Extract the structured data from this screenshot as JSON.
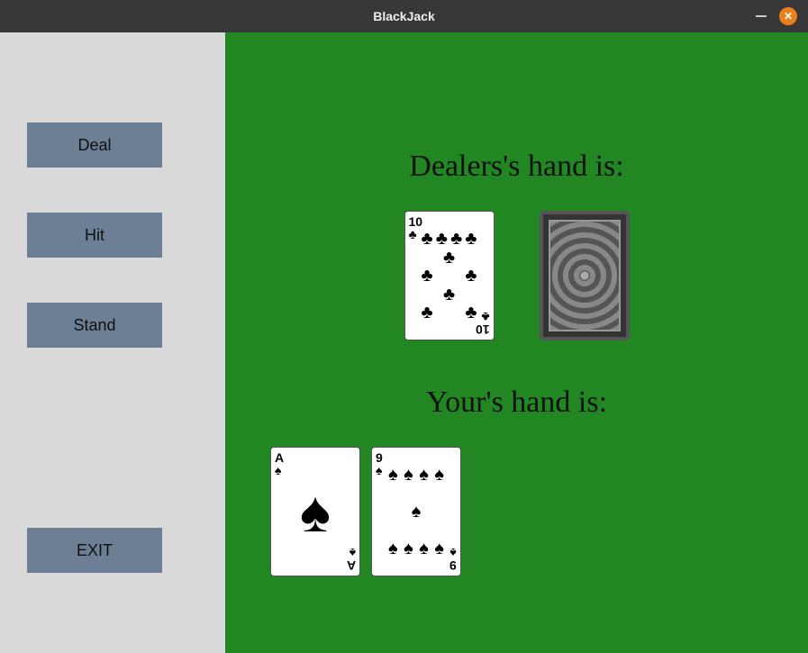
{
  "window": {
    "title": "BlackJack"
  },
  "sidebar": {
    "deal": "Deal",
    "hit": "Hit",
    "stand": "Stand",
    "exit": "EXIT"
  },
  "game": {
    "dealer_label": "Dealers's hand is:",
    "player_label": "Your's hand is:",
    "dealer_hand": [
      {
        "rank": "10",
        "suit": "clubs",
        "face_up": true
      },
      {
        "rank": "?",
        "suit": "?",
        "face_up": false
      }
    ],
    "player_hand": [
      {
        "rank": "A",
        "suit": "spades",
        "face_up": true
      },
      {
        "rank": "9",
        "suit": "spades",
        "face_up": true
      }
    ]
  },
  "glyphs": {
    "clubs": "♣",
    "spades": "♠",
    "hearts": "♥",
    "diamonds": "♦"
  },
  "colors": {
    "felt": "#228722",
    "sidebar": "#d9d9d9",
    "button": "#6d7f95",
    "titlebar": "#373737",
    "close": "#e9801d"
  }
}
